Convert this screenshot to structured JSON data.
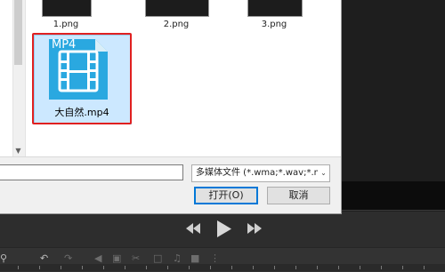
{
  "dialog": {
    "thumbnails": [
      {
        "label": "1.png"
      },
      {
        "label": "2.png"
      },
      {
        "label": "3.png"
      }
    ],
    "selected_file": {
      "name": "大自然.mp4",
      "icon_text": "MP4",
      "icon": "mp4-file-icon"
    },
    "filename_value": "",
    "filetype_value": "多媒体文件 (*.wma;*.wav;*.mp",
    "open_button": "打开(O)",
    "cancel_button": "取消"
  },
  "player": {
    "controls": [
      "rewind-icon",
      "play-icon",
      "fast-forward-icon"
    ]
  },
  "colors": {
    "highlight": "#e02020",
    "selection": "#cce8ff",
    "icon_blue": "#2aa8e0"
  }
}
